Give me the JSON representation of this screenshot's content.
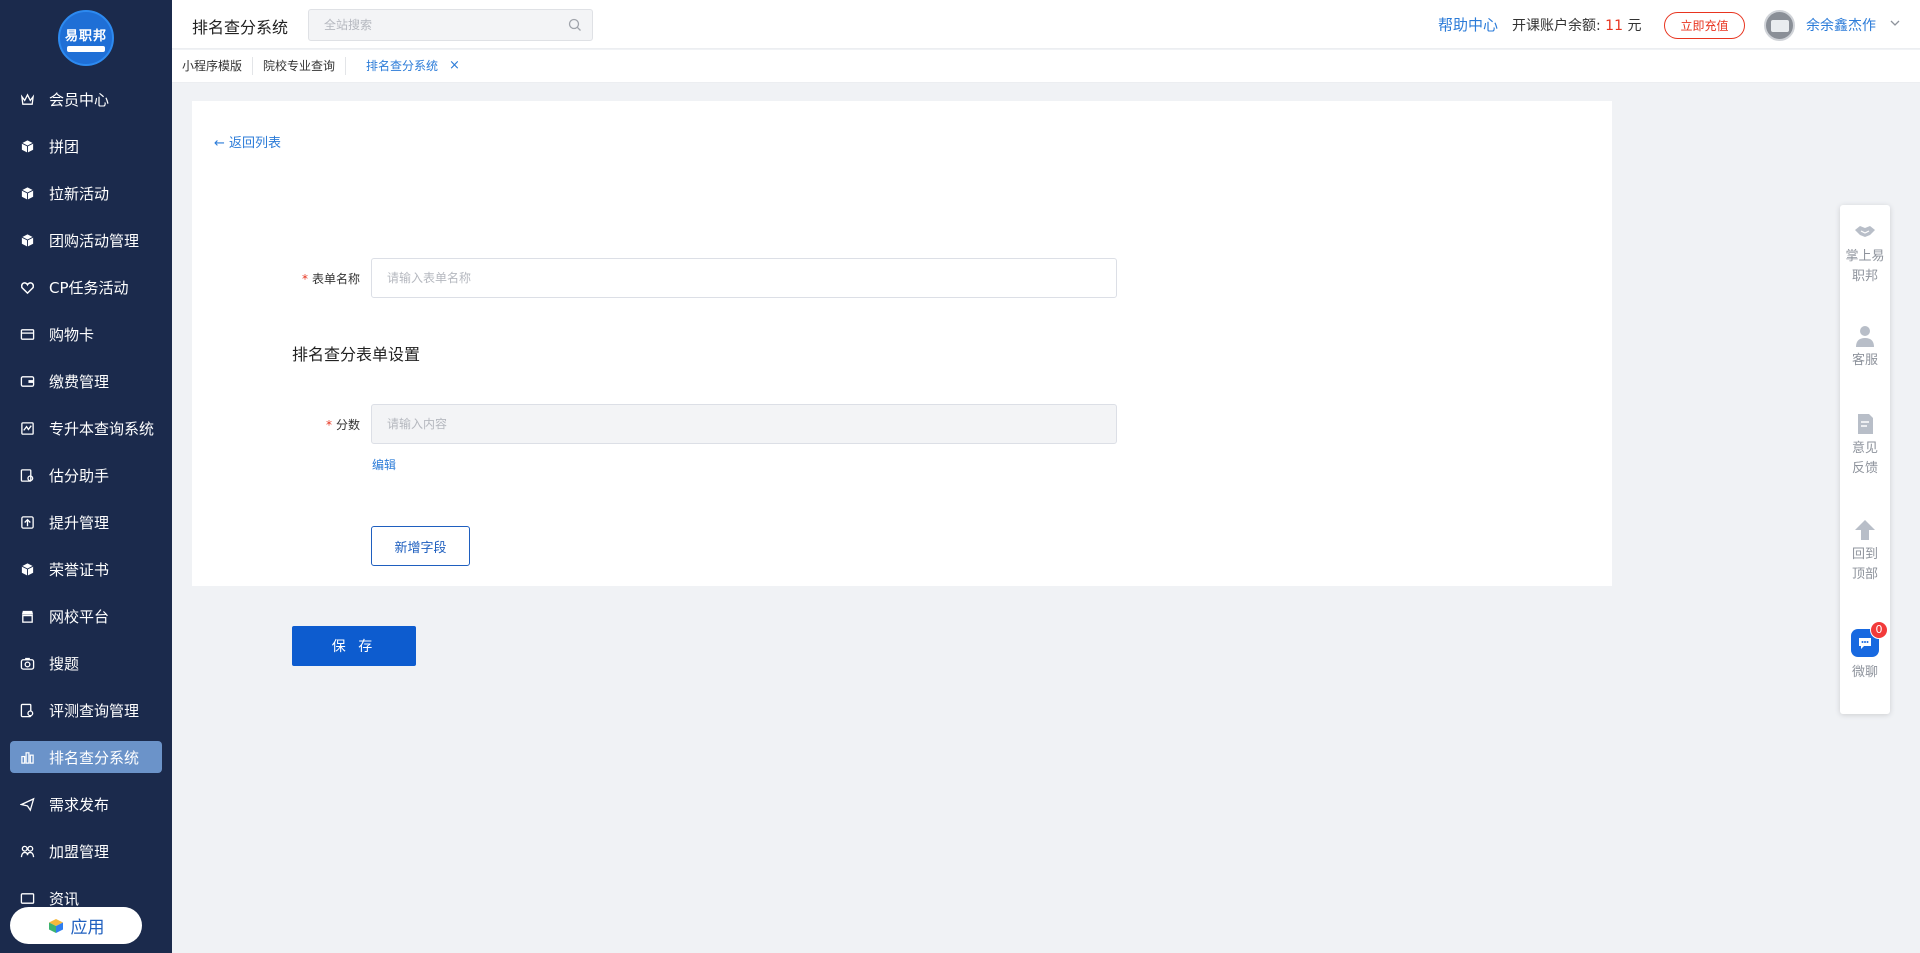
{
  "sidebar": {
    "logo_text": "易职邦",
    "items": [
      {
        "label": "会员中心",
        "icon": "crown-icon"
      },
      {
        "label": "拼团",
        "icon": "cube-icon"
      },
      {
        "label": "拉新活动",
        "icon": "cube-icon"
      },
      {
        "label": "团购活动管理",
        "icon": "cube-icon"
      },
      {
        "label": "CP任务活动",
        "icon": "heart-icon"
      },
      {
        "label": "购物卡",
        "icon": "card-icon"
      },
      {
        "label": "缴费管理",
        "icon": "wallet-icon"
      },
      {
        "label": "专升本查询系统",
        "icon": "book-icon"
      },
      {
        "label": "估分助手",
        "icon": "chart-search-icon"
      },
      {
        "label": "提升管理",
        "icon": "upload-box-icon"
      },
      {
        "label": "荣誉证书",
        "icon": "cube-icon"
      },
      {
        "label": "网校平台",
        "icon": "store-icon"
      },
      {
        "label": "搜题",
        "icon": "camera-icon"
      },
      {
        "label": "评测查询管理",
        "icon": "doc-search-icon"
      },
      {
        "label": "排名查分系统",
        "icon": "bar-chart-icon",
        "active": true
      },
      {
        "label": "需求发布",
        "icon": "send-icon"
      },
      {
        "label": "加盟管理",
        "icon": "group-icon"
      },
      {
        "label": "资讯",
        "icon": "news-icon"
      }
    ],
    "app_button": "应用"
  },
  "header": {
    "title": "排名查分系统",
    "search_placeholder": "全站搜索",
    "help": "帮助中心",
    "balance_label": "开课账户余额:",
    "balance_value": "11",
    "balance_unit": "元",
    "recharge": "立即充值",
    "username": "余余鑫杰作"
  },
  "tabs": [
    {
      "label": "小程序模版"
    },
    {
      "label": "院校专业查询"
    },
    {
      "label": "排名查分系统",
      "active": true,
      "close": "×"
    }
  ],
  "form": {
    "back": "返回列表",
    "name_label": "表单名称",
    "name_placeholder": "请输入表单名称",
    "section_title": "排名查分表单设置",
    "score_label": "分数",
    "score_placeholder": "请输入内容",
    "edit": "编辑",
    "add_field": "新增字段",
    "save": "保 存"
  },
  "float_panel": {
    "mobile": "掌上易职邦",
    "service": "客服",
    "feedback": "意见反馈",
    "top": "回到顶部",
    "chat": "微聊",
    "chat_badge": "0"
  },
  "colors": {
    "sidebar_bg": "#1b2a4c",
    "accent": "#2b7bd8",
    "primary_button": "#0d5ccf",
    "danger": "#e8341f"
  }
}
